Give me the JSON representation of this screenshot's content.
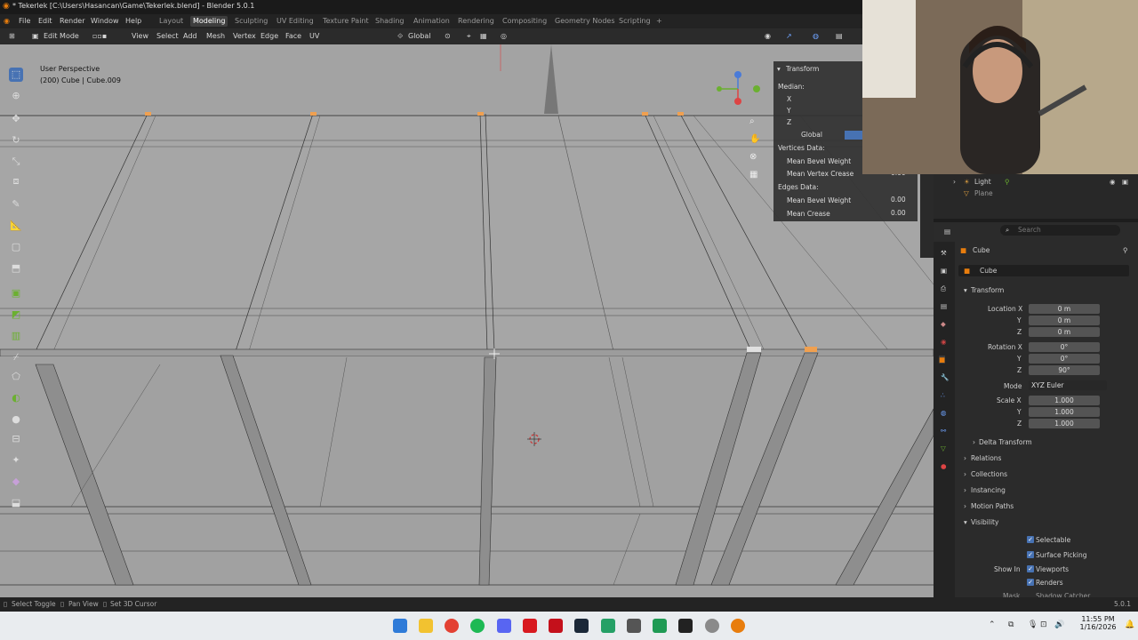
{
  "window": {
    "title": "* Tekerlek [C:\\Users\\Hasancan\\Game\\Tekerlek.blend] - Blender 5.0.1"
  },
  "menu": {
    "items": [
      "File",
      "Edit",
      "Render",
      "Window",
      "Help"
    ]
  },
  "workspaces": [
    {
      "label": "Layout",
      "active": false
    },
    {
      "label": "Modeling",
      "active": true
    },
    {
      "label": "Sculpting",
      "active": false
    },
    {
      "label": "UV Editing",
      "active": false
    },
    {
      "label": "Texture Paint",
      "active": false
    },
    {
      "label": "Shading",
      "active": false
    },
    {
      "label": "Animation",
      "active": false
    },
    {
      "label": "Rendering",
      "active": false
    },
    {
      "label": "Compositing",
      "active": false
    },
    {
      "label": "Geometry Nodes",
      "active": false
    },
    {
      "label": "Scripting",
      "active": false
    }
  ],
  "header": {
    "mode": "Edit Mode",
    "menus": [
      "View",
      "Select",
      "Add",
      "Mesh",
      "Vertex",
      "Edge",
      "Face",
      "UV"
    ],
    "orientation": "Global"
  },
  "viewport": {
    "perspective": "User Perspective",
    "object_info": "(200) Cube | Cube.009"
  },
  "npanel": {
    "title": "Transform",
    "median": "Median:",
    "axes": [
      "X",
      "Y",
      "Z"
    ],
    "space_global": "Global",
    "vertices_data": "Vertices Data:",
    "mean_bevel_weight": "Mean Bevel Weight",
    "mean_vertex_crease": "Mean Vertex Crease",
    "mean_vertex_crease_value": "0.00",
    "edges_data": "Edges Data:",
    "edge_mean_bevel_weight": "Mean Bevel Weight",
    "edge_mean_bevel_weight_value": "0.00",
    "mean_crease": "Mean Crease",
    "mean_crease_value": "0.00"
  },
  "outliner": {
    "items": [
      "Light",
      "Plane"
    ]
  },
  "properties": {
    "search_placeholder": "Search",
    "object_name": "Cube",
    "data_name": "Cube",
    "transform_label": "Transform",
    "location_x_label": "Location X",
    "location": [
      "0 m",
      "0 m",
      "0 m"
    ],
    "rotation_x_label": "Rotation X",
    "rotation": [
      "0°",
      "0°",
      "90°"
    ],
    "mode_label": "Mode",
    "mode_value": "XYZ Euler",
    "scale_x_label": "Scale X",
    "scale": [
      "1.000",
      "1.000",
      "1.000"
    ],
    "y": "Y",
    "z": "Z",
    "sections": [
      "Delta Transform",
      "Relations",
      "Collections",
      "Instancing",
      "Motion Paths",
      "Visibility"
    ],
    "selectable": "Selectable",
    "surface_picking": "Surface Picking",
    "show_in": "Show In",
    "viewports": "Viewports",
    "renders": "Renders",
    "mask": "Mask",
    "shadow_catcher": "Shadow Catcher"
  },
  "statusbar": {
    "items": [
      "Select Toggle",
      "Pan View",
      "Set 3D Cursor"
    ],
    "version": "5.0.1"
  },
  "taskbar": {
    "time": "11:55 PM",
    "date": "1/16/2026"
  },
  "colors": {
    "accent": "#4772b3",
    "viewport_bg": "#a3a3a3",
    "selected_vertex": "#f0a050"
  }
}
